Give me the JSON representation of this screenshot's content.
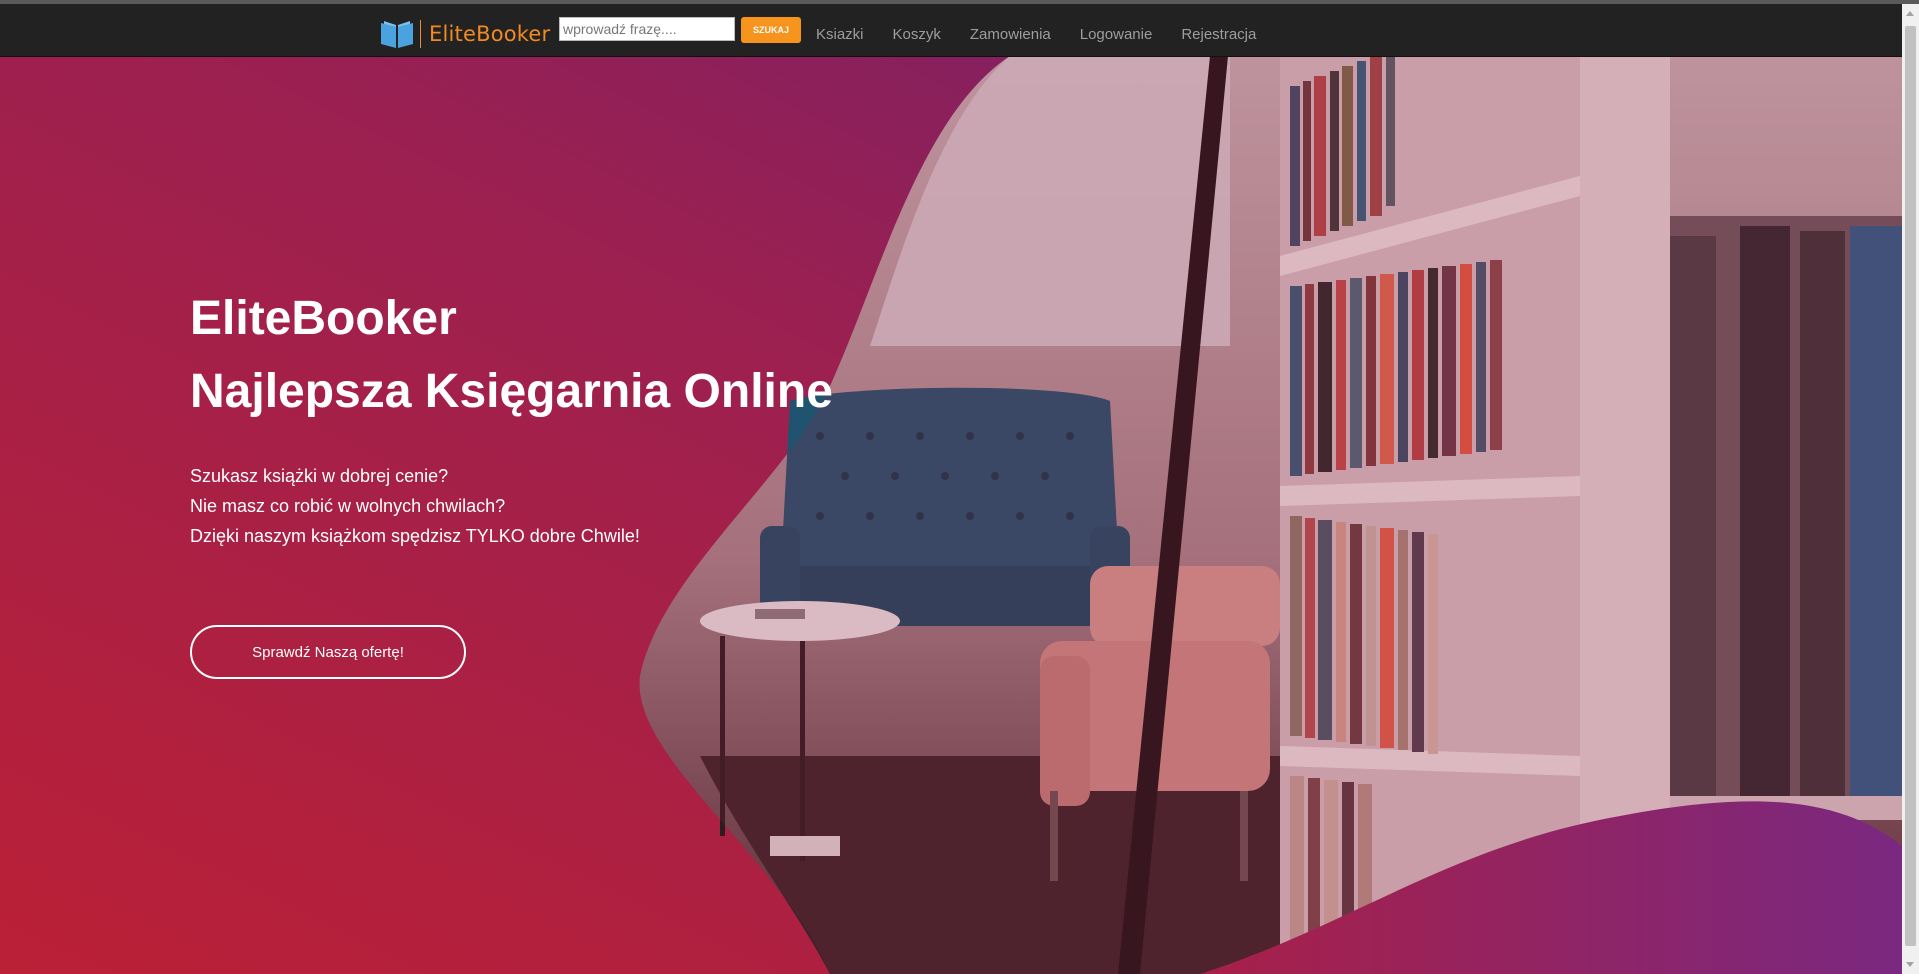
{
  "navbar": {
    "brand": "EliteBooker",
    "brand_icon": "open-book-icon",
    "search_placeholder": "wprowadź frazę....",
    "search_button": "SZUKAJ",
    "links": [
      "Ksiazki",
      "Koszyk",
      "Zamowienia",
      "Logowanie",
      "Rejestracja"
    ]
  },
  "hero": {
    "title_lines": [
      "EliteBooker",
      "Najlepsza Księgarnia Online"
    ],
    "text_lines": [
      "Szukasz książki w dobrej cenie?",
      "Nie masz co robić w wolnych chwilach?",
      "Dzięki naszym książkom spędzisz TYLKO dobre Chwile!"
    ],
    "cta_label": "Sprawdź Naszą ofertę!"
  },
  "colors": {
    "navbar_bg": "#222222",
    "brand": "#f08a24",
    "search_button": "#f7941d",
    "gradient_start": "#bb2036",
    "gradient_end": "#6a1f7a"
  }
}
